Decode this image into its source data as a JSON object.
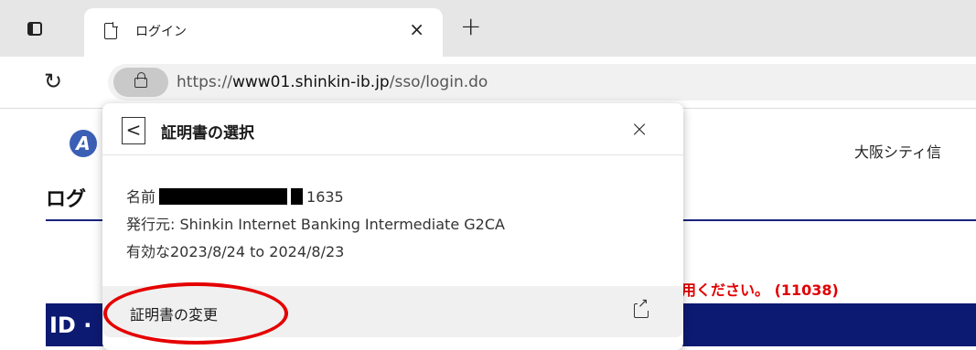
{
  "browser": {
    "tab_title": "ログイン",
    "tab_close": "×",
    "new_tab": "+",
    "url_prefix": "https://",
    "url_host": "www01.shinkin-ib.jp",
    "url_path": "/sso/login.do"
  },
  "page": {
    "logo_text": "A",
    "bank_name": "大阪シティ信",
    "login_heading": "ログ",
    "error_text": "用ください。 (11038)",
    "id_bar_text": "ID ·"
  },
  "popup": {
    "back_label": "<",
    "title": "証明書の選択",
    "close_label": "×",
    "name_label": "名前",
    "name_suffix": "1635",
    "issuer": "発行元: Shinkin Internet Banking Intermediate G2CA",
    "validity": "有効な2023/8/24 to 2024/8/23",
    "change_cert_label": "証明書の変更"
  },
  "annotation": {
    "highlight_color": "#e50000"
  }
}
